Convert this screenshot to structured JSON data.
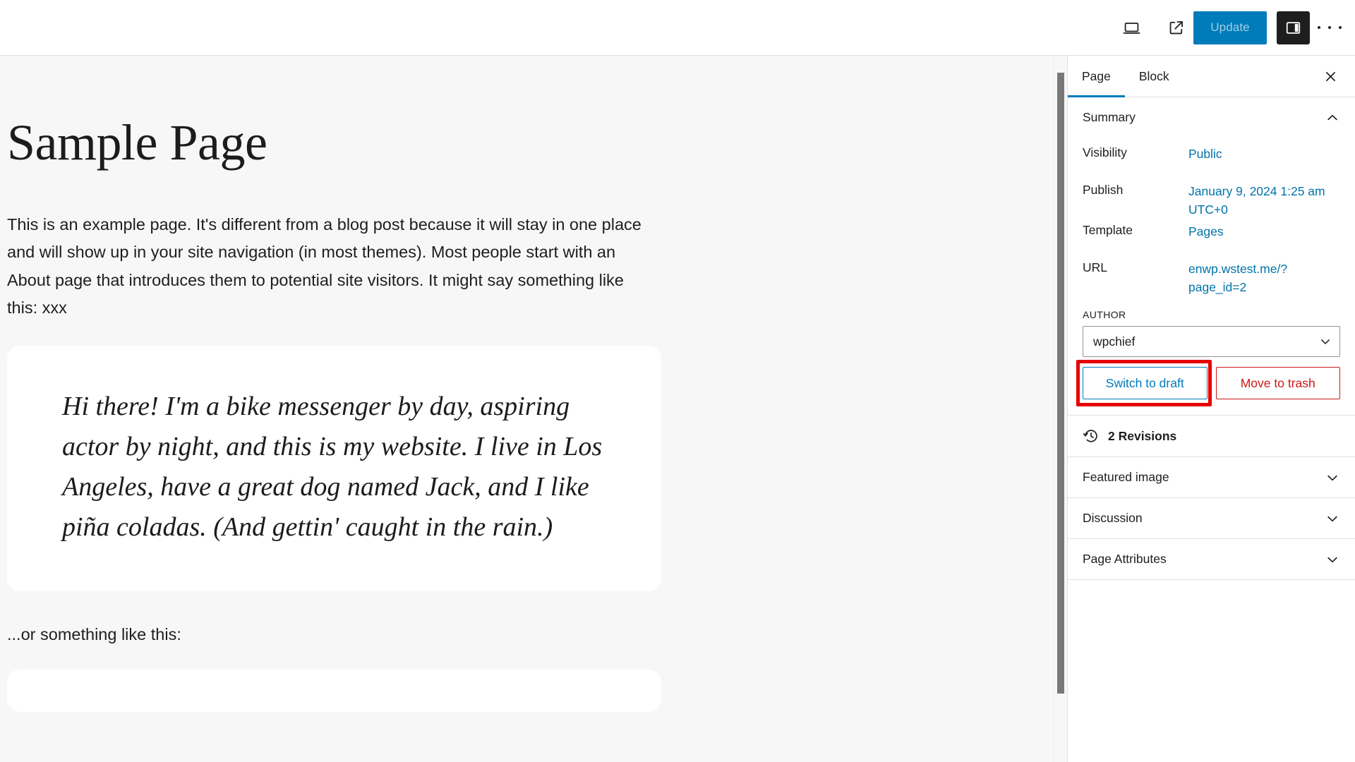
{
  "header": {
    "preview_icon": "laptop-preview-icon",
    "view_icon": "external-link-icon",
    "update_label": "Update",
    "sidebar_toggle_icon": "sidebar-panel-icon",
    "more_menu_icon": "kebab-menu-icon",
    "accent_blue": "#007cba",
    "toggle_active_bg": "#1e1e1e"
  },
  "editor": {
    "title": "Sample Page",
    "intro_paragraph": "This is an example page. It's different from a blog post because it will stay in one place and will show up in your site navigation (in most themes). Most people start with an About page that introduces them to potential site visitors. It might say something like this: xxx",
    "quote": "Hi there! I'm a bike messenger by day, aspiring actor by night, and this is my website. I live in Los Angeles, have a great dog named Jack, and I like piña coladas. (And gettin' caught in the rain.)",
    "closing_paragraph": "...or something like this:",
    "canvas_background": "#f7f7f7",
    "card_background": "#ffffff"
  },
  "sidebar": {
    "tabs": [
      {
        "label": "Page",
        "active": true
      },
      {
        "label": "Block",
        "active": false
      }
    ],
    "close_icon": "close-icon",
    "summary": {
      "title": "Summary",
      "chevron": "chevron-up-icon",
      "rows": [
        {
          "label": "Visibility",
          "value": "Public"
        },
        {
          "label": "Publish",
          "value": "January 9, 2024 1:25 am UTC+0"
        },
        {
          "label": "Template",
          "value": "Pages"
        },
        {
          "label": "URL",
          "value": "enwp.wstest.me/?page_id=2"
        }
      ],
      "author_label": "AUTHOR",
      "author_value": "wpchief",
      "author_options": [
        "wpchief"
      ],
      "switch_to_draft_label": "Switch to draft",
      "move_to_trash_label": "Move to trash",
      "annotation_color": "#e60000"
    },
    "revisions": {
      "icon": "revisions-clock-icon",
      "label": "2 Revisions"
    },
    "panels": [
      {
        "label": "Featured image",
        "chevron": "chevron-down-icon"
      },
      {
        "label": "Discussion",
        "chevron": "chevron-down-icon"
      },
      {
        "label": "Page Attributes",
        "chevron": "chevron-down-icon"
      }
    ]
  }
}
